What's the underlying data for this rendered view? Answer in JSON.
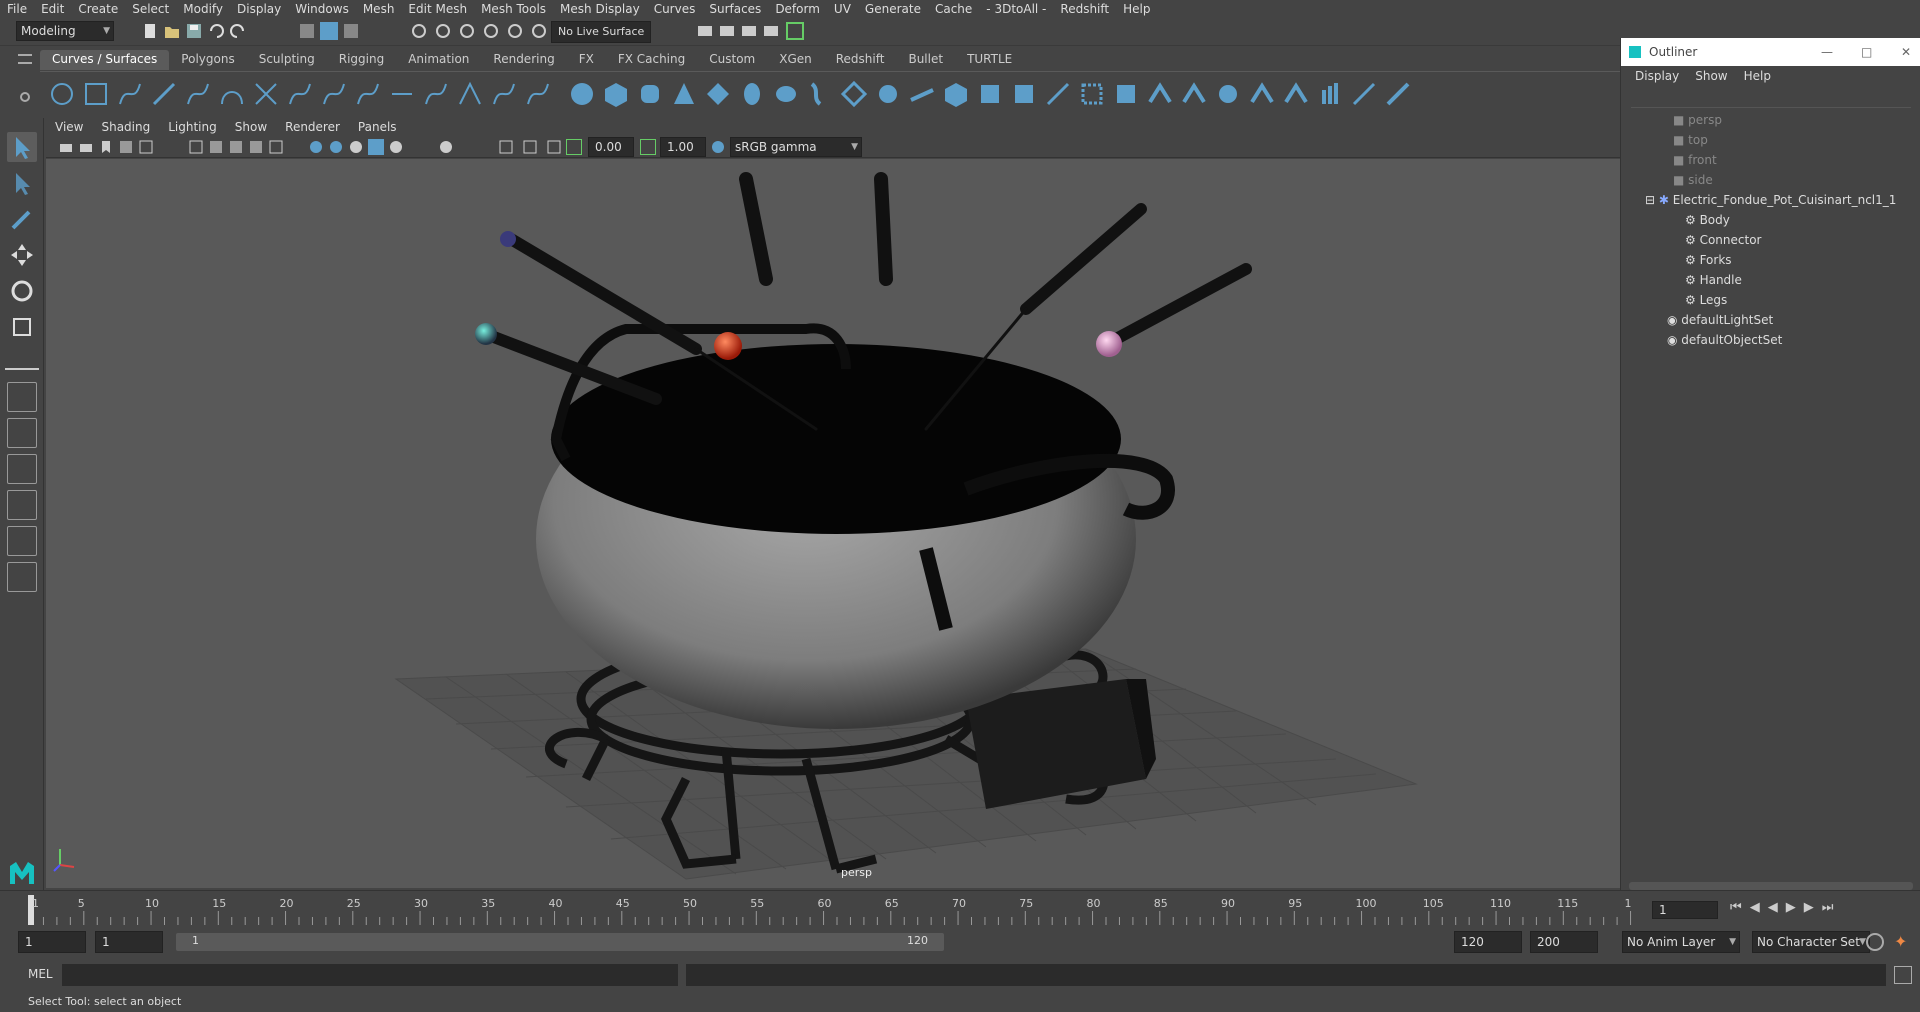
{
  "menubar": [
    "File",
    "Edit",
    "Create",
    "Select",
    "Modify",
    "Display",
    "Windows",
    "Mesh",
    "Edit Mesh",
    "Mesh Tools",
    "Mesh Display",
    "Curves",
    "Surfaces",
    "Deform",
    "UV",
    "Generate",
    "Cache",
    "- 3DtoAll -",
    "Redshift",
    "Help"
  ],
  "status": {
    "mode": "Modeling",
    "live_surface": "No Live Surface"
  },
  "shelf_tabs": [
    "Curves / Surfaces",
    "Polygons",
    "Sculpting",
    "Rigging",
    "Animation",
    "Rendering",
    "FX",
    "FX Caching",
    "Custom",
    "XGen",
    "Redshift",
    "Bullet",
    "TURTLE"
  ],
  "viewport_menu": [
    "View",
    "Shading",
    "Lighting",
    "Show",
    "Renderer",
    "Panels"
  ],
  "viewport_toolbar": {
    "exposure": "0.00",
    "gamma": "1.00",
    "color_space": "sRGB gamma"
  },
  "viewport": {
    "camera_label": "persp"
  },
  "outliner": {
    "title": "Outliner",
    "menu": [
      "Display",
      "Show",
      "Help"
    ],
    "items": [
      {
        "label": "persp",
        "dim": true
      },
      {
        "label": "top",
        "dim": true
      },
      {
        "label": "front",
        "dim": true
      },
      {
        "label": "side",
        "dim": true
      },
      {
        "label": "Electric_Fondue_Pot_Cuisinart_ncl1_1"
      },
      {
        "label": "Body"
      },
      {
        "label": "Connector"
      },
      {
        "label": "Forks"
      },
      {
        "label": "Handle"
      },
      {
        "label": "Legs"
      },
      {
        "label": "defaultLightSet"
      },
      {
        "label": "defaultObjectSet"
      }
    ]
  },
  "timeslider": {
    "ticks": [
      "1",
      "5",
      "10",
      "15",
      "20",
      "25",
      "30",
      "35",
      "40",
      "45",
      "50",
      "55",
      "60",
      "65",
      "70",
      "75",
      "80",
      "85",
      "90",
      "95",
      "100",
      "105",
      "110",
      "115",
      "1"
    ],
    "current_frame": "1"
  },
  "range": {
    "start": "1",
    "start2": "1",
    "slider_start": "1",
    "slider_end": "120",
    "end": "120",
    "end2": "200",
    "anim_layer": "No Anim Layer",
    "char_set": "No Character Set"
  },
  "cmdline": {
    "label": "MEL"
  },
  "helpline": {
    "text": "Select Tool: select an object"
  },
  "colors": {
    "accent": "#5d9ec9",
    "background": "#444444",
    "viewport": "#595959"
  }
}
